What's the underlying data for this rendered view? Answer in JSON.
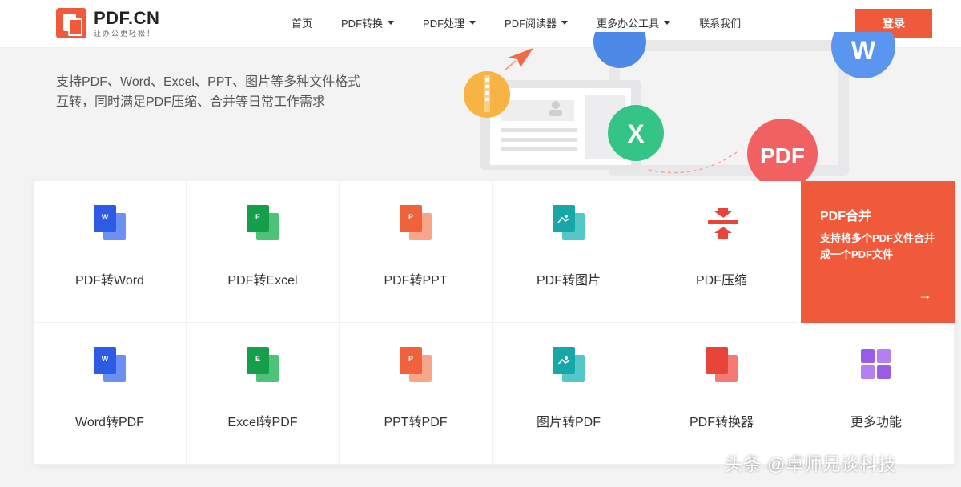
{
  "brand": {
    "name": "PDF.CN",
    "slogan": "让办公更轻松！",
    "accent_color": "#f05a3a"
  },
  "nav": {
    "items": [
      {
        "label": "首页",
        "dropdown": false
      },
      {
        "label": "PDF转换",
        "dropdown": true
      },
      {
        "label": "PDF处理",
        "dropdown": true
      },
      {
        "label": "PDF阅读器",
        "dropdown": true
      },
      {
        "label": "更多办公工具",
        "dropdown": true
      },
      {
        "label": "联系我们",
        "dropdown": false
      }
    ],
    "login_label": "登录"
  },
  "hero": {
    "line1": "支持PDF、Word、Excel、PPT、图片等多种文件格式",
    "line2": "互转，同时满足PDF压缩、合并等日常工作需求",
    "art": {
      "excel_badge": "X",
      "pdf_badge": "PDF",
      "word_badge": "W"
    }
  },
  "tools": {
    "row1": [
      {
        "label": "PDF转Word",
        "icon": "word-doc-icon",
        "letter": "W",
        "color": "blue"
      },
      {
        "label": "PDF转Excel",
        "icon": "excel-doc-icon",
        "letter": "E",
        "color": "green"
      },
      {
        "label": "PDF转PPT",
        "icon": "ppt-doc-icon",
        "letter": "P",
        "color": "orange"
      },
      {
        "label": "PDF转图片",
        "icon": "image-doc-icon",
        "letter": "",
        "color": "teal"
      },
      {
        "label": "PDF压缩",
        "icon": "compress-icon",
        "color": "red"
      }
    ],
    "row2": [
      {
        "label": "Word转PDF",
        "icon": "word-doc-icon",
        "letter": "W",
        "color": "blue"
      },
      {
        "label": "Excel转PDF",
        "icon": "excel-doc-icon",
        "letter": "E",
        "color": "green"
      },
      {
        "label": "PPT转PDF",
        "icon": "ppt-doc-icon",
        "letter": "P",
        "color": "orange"
      },
      {
        "label": "图片转PDF",
        "icon": "image-doc-icon",
        "letter": "",
        "color": "teal"
      },
      {
        "label": "PDF转换器",
        "icon": "converter-icon",
        "color": "red"
      },
      {
        "label": "更多功能",
        "icon": "grid-apps-icon",
        "color": "purple"
      }
    ],
    "highlight": {
      "title": "PDF合并",
      "description": "支持将多个PDF文件合并成一个PDF文件",
      "arrow": "→"
    }
  },
  "watermark": "头条 @卓师兄谈科技"
}
